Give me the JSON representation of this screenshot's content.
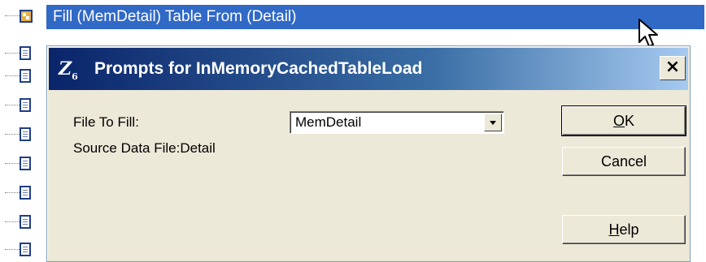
{
  "background": {
    "selected_row": {
      "text": "Fill (MemDetail) Table From (Detail)"
    },
    "partial_row_text": "Fill (MemDetail) Table From (Detail)"
  },
  "dialog": {
    "title": "Prompts for InMemoryCachedTableLoad",
    "app_icon_text": "Z",
    "app_icon_sub": "6",
    "close_label": "×",
    "fields": {
      "file_to_fill_label": "File To Fill:",
      "file_to_fill_value": "MemDetail",
      "source_label": "Source Data File:Detail"
    },
    "buttons": {
      "ok_mnemonic": "O",
      "ok_rest": "K",
      "cancel": "Cancel",
      "help_mnemonic": "H",
      "help_rest": "elp"
    }
  },
  "colors": {
    "selection": "#3169c6",
    "title_start": "#0a246a",
    "title_end": "#a6caf0",
    "dialog_face": "#ece9d8"
  }
}
